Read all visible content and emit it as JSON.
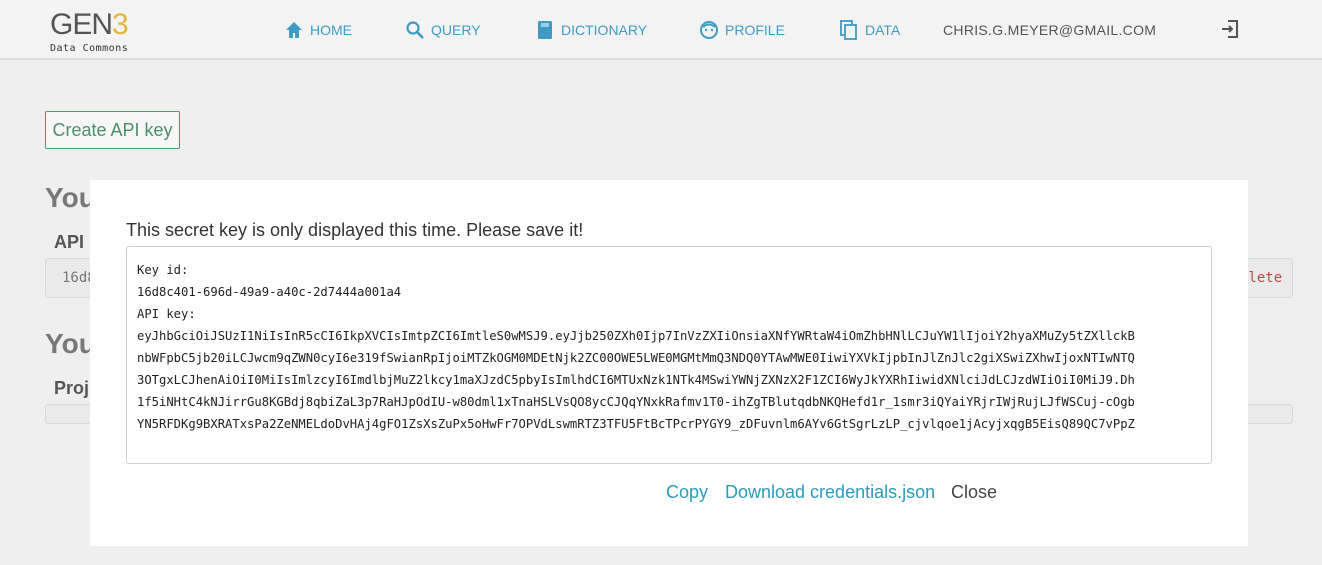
{
  "logo": {
    "word": "GEN",
    "number": "3",
    "subtitle": "Data Commons"
  },
  "nav": {
    "home": "HOME",
    "query": "QUERY",
    "dictionary": "DICTIONARY",
    "profile": "PROFILE",
    "data": "DATA"
  },
  "user": {
    "email": "CHRIS.G.MEYER@GMAIL.COM"
  },
  "background": {
    "create_button": "Create API key",
    "heading1": "You",
    "label1": "API I",
    "key_preview": "16d8",
    "delete_label": "elete",
    "heading2": "You",
    "label2": "Proj"
  },
  "modal": {
    "message": "This secret key is only displayed this time. Please save it!",
    "key_id_label": "Key id:",
    "key_id": "16d8c401-696d-49a9-a40c-2d7444a001a4",
    "api_key_label": "API key:",
    "api_key_lines": [
      "eyJhbGciOiJSUzI1NiIsInR5cCI6IkpXVCIsImtpZCI6ImtleS0wMSJ9.eyJjb250ZXh0Ijp7InVzZXIiOnsiaXNfYWRtaW4iOmZhbHNlLCJuYW1lIjoiY2hyaXMuZy5tZXllckB",
      "nbWFpbC5jb20iLCJwcm9qZWN0cyI6e319fSwianRpIjoiMTZkOGM0MDEtNjk2ZC00OWE5LWE0MGMtMmQ3NDQ0YTAwMWE0IiwiYXVkIjpbInJlZnJlc2giXSwiZXhwIjoxNTIwNTQ",
      "3OTgxLCJhenAiOiI0MiIsImlzcyI6ImdlbjMuZ2lkcy1maXJzdC5pbyIsImlhdCI6MTUxNzk1NTk4MSwiYWNjZXNzX2F1ZCI6WyJkYXRhIiwidXNlciJdLCJzdWIiOiI0MiJ9.Dh",
      "1f5iNHtC4kNJirrGu8KGBdj8qbiZaL3p7RaHJpOdIU-w80dml1xTnaHSLVsQO8ycCJQqYNxkRafmv1T0-ihZgTBlutqdbNKQHefd1r_1smr3iQYaiYRjrIWjRujLJfWSCuj-cOgb",
      "YN5RFDKg9BXRATxsPa2ZeNMELdoDvHAj4gFO1ZsXsZuPx5oHwFr7OPVdLswmRTZ3TFU5FtBcTPcrPYGY9_zDFuvnlm6AYv6GtSgrLzLP_cjvlqoe1jAcyjxqgB5EisQ89QC7vPpZ"
    ],
    "copy": "Copy",
    "download": "Download credentials.json",
    "close": "Close"
  },
  "colors": {
    "accent": "#3f9bc4",
    "link": "#2b9cba",
    "logo_three": "#e4b73f"
  }
}
